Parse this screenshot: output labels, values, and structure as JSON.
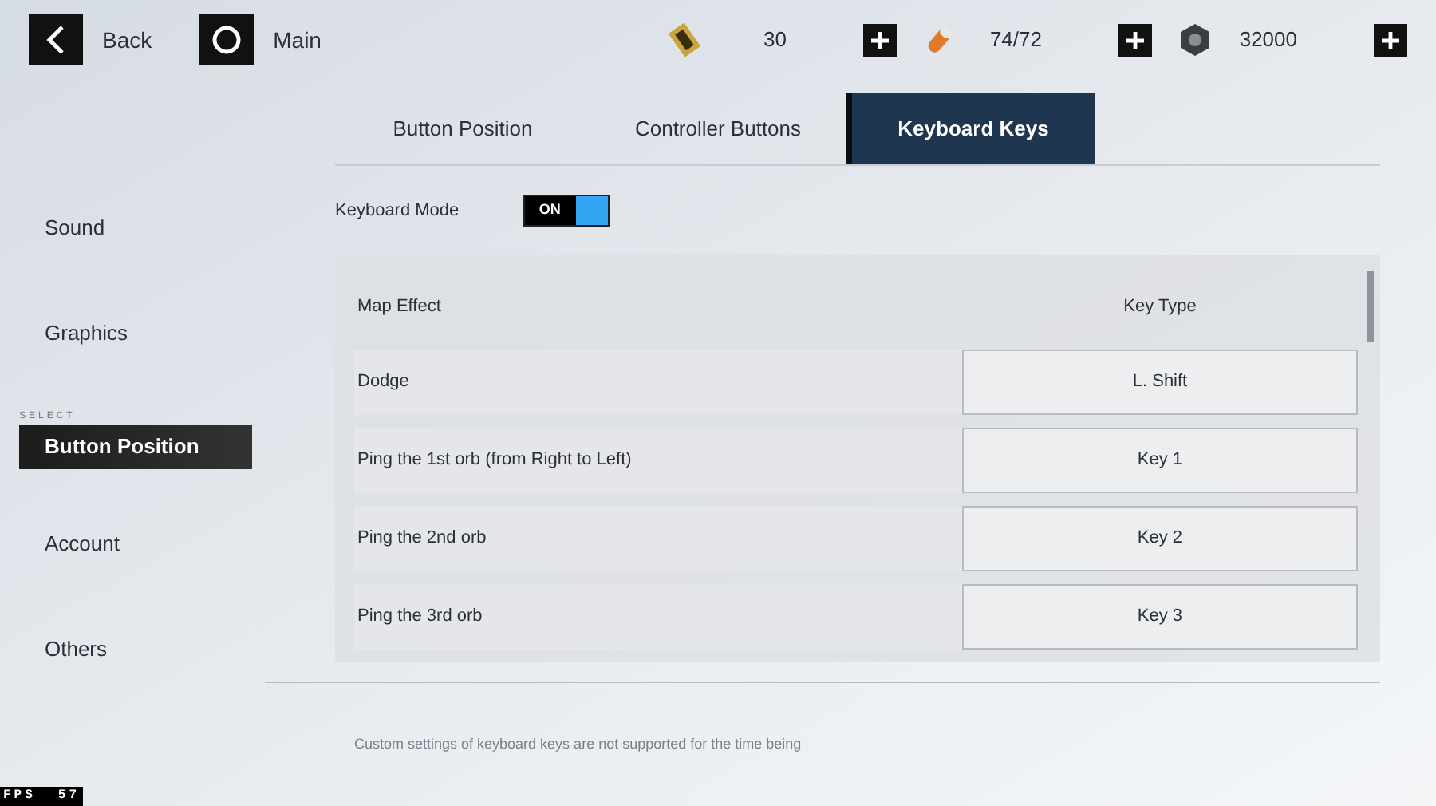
{
  "top_bar": {
    "back": {
      "label": "Back"
    },
    "main": {
      "label": "Main"
    },
    "currencies": [
      {
        "kind": "ticket",
        "value": "30"
      },
      {
        "kind": "capsule",
        "value": "74/72"
      },
      {
        "kind": "nut",
        "value": "32000"
      }
    ]
  },
  "sidebar": {
    "items": [
      {
        "label": "Sound",
        "selected": false
      },
      {
        "label": "Graphics",
        "selected": false
      },
      {
        "label": "Button Position",
        "selected": true,
        "tag": "SELECT"
      },
      {
        "label": "Account",
        "selected": false
      },
      {
        "label": "Others",
        "selected": false
      }
    ]
  },
  "tabs": [
    {
      "label": "Button Position",
      "selected": false
    },
    {
      "label": "Controller Buttons",
      "selected": false
    },
    {
      "label": "Keyboard Keys",
      "selected": true
    }
  ],
  "keyboard_mode": {
    "label": "Keyboard Mode",
    "on": true,
    "text": "ON"
  },
  "table": {
    "columns": [
      "Map Effect",
      "Key Type"
    ],
    "rows": [
      {
        "effect": "Dodge",
        "key": "L. Shift"
      },
      {
        "effect": "Ping the 1st orb (from Right to Left)",
        "key": "Key 1"
      },
      {
        "effect": "Ping the 2nd orb",
        "key": "Key 2"
      },
      {
        "effect": "Ping the 3rd orb",
        "key": "Key 3"
      }
    ]
  },
  "footer_note": "Custom settings of keyboard keys are not supported for the time being",
  "fps": {
    "label": "FPS",
    "value": "57"
  }
}
